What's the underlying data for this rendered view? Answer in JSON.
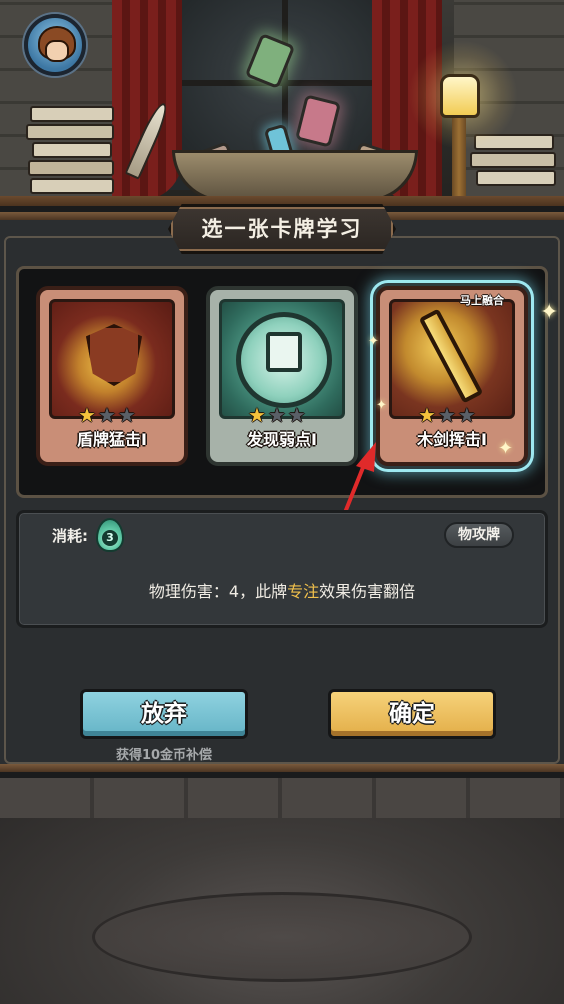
{
  "dialog": {
    "title": "选一张卡牌学习"
  },
  "cards": [
    {
      "name": "盾牌猛击I",
      "stars_filled": 1,
      "stars_total": 3,
      "selected": false,
      "badge": ""
    },
    {
      "name": "发现弱点I",
      "stars_filled": 1,
      "stars_total": 3,
      "selected": false,
      "badge": ""
    },
    {
      "name": "木剑挥击I",
      "stars_filled": 1,
      "stars_total": 3,
      "selected": true,
      "badge": "马上融合"
    }
  ],
  "details": {
    "cost_label": "消耗:",
    "cost_value": "3",
    "type_tag": "物攻牌",
    "description_before": "物理伤害：4，此牌",
    "description_highlight": "专注",
    "description_after": "效果伤害翻倍"
  },
  "buttons": {
    "abandon_label": "放弃",
    "confirm_label": "确定",
    "compensation_text": "获得10金币补偿"
  },
  "colors": {
    "highlight_text": "#f2c14c",
    "abandon_button": "#65b4c6",
    "confirm_button": "#e3ae48",
    "selected_glow": "#9ee8f0",
    "star_on": "#f4c23c",
    "star_off": "#5a6068"
  },
  "icons": {
    "avatar": "player-avatar",
    "cost": "flame-energy-icon",
    "star": "star-icon",
    "sparkle": "sparkle-icon",
    "arrow": "red-arrow-indicator"
  }
}
